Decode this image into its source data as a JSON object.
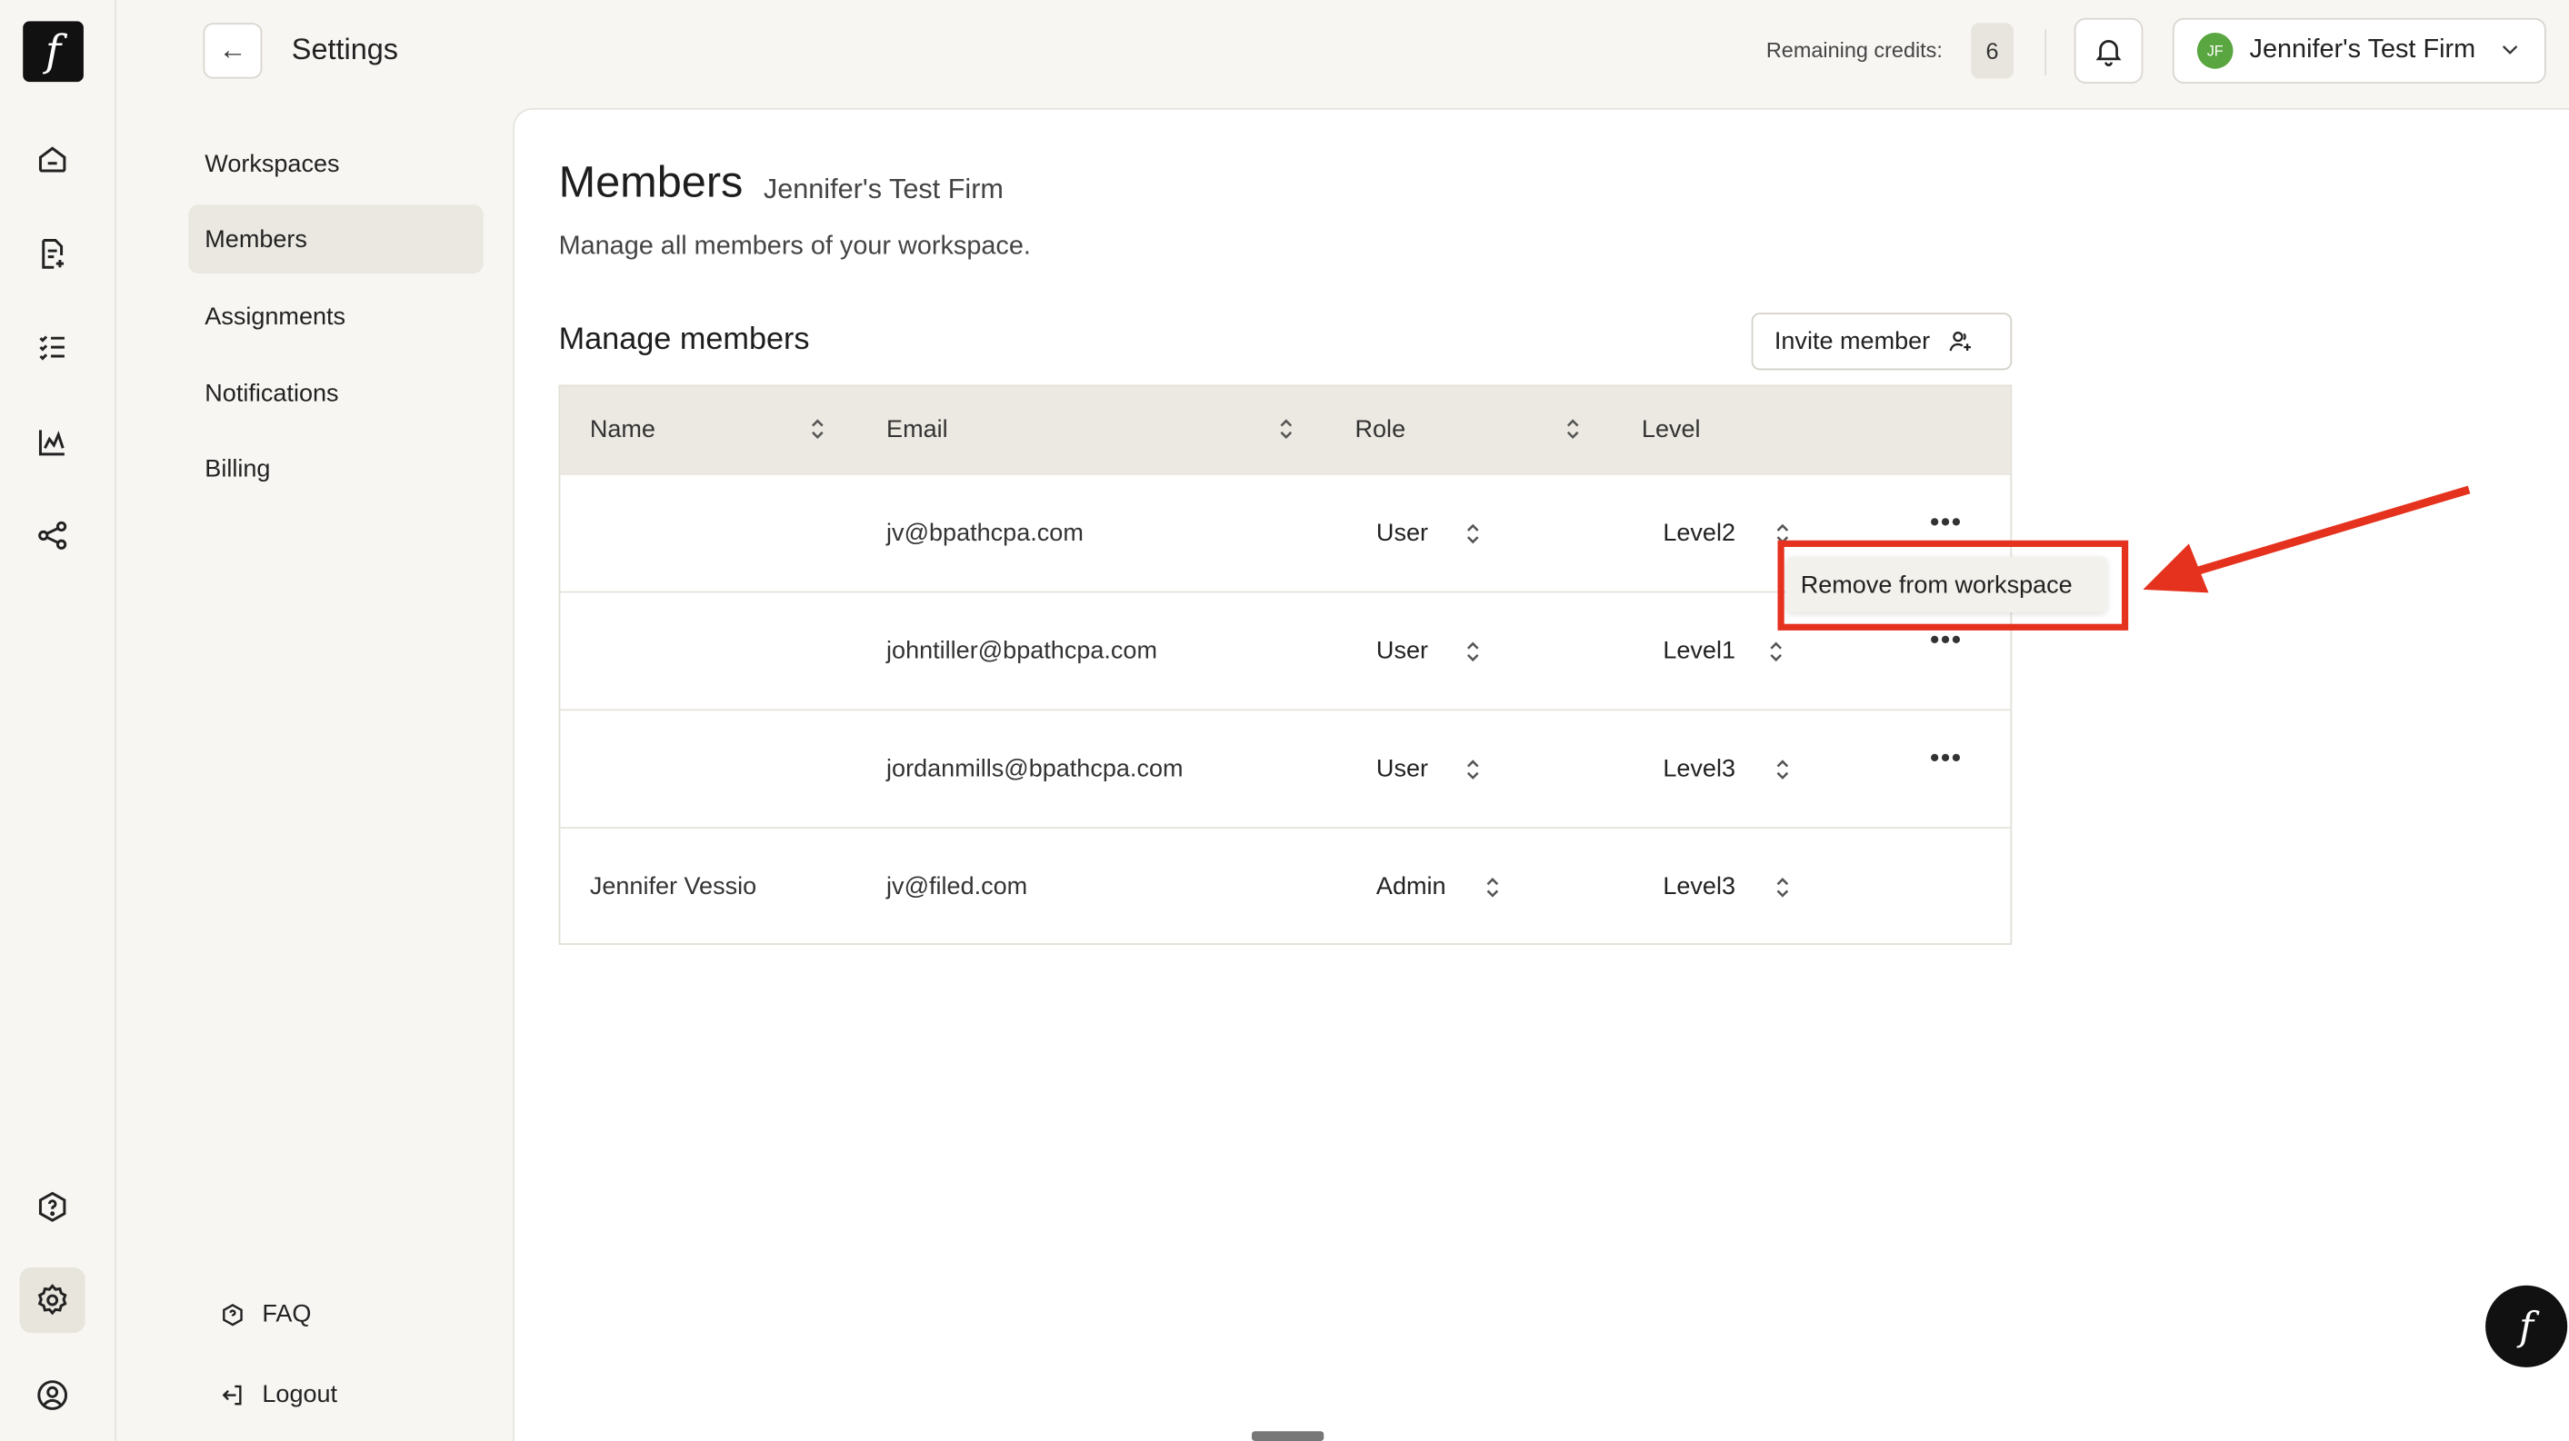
{
  "brand": {
    "logo_glyph": "f",
    "accent": "#e5321e"
  },
  "topbar": {
    "back_icon": "arrow-left-icon",
    "title": "Settings",
    "credits_label": "Remaining credits:",
    "credits_value": "6",
    "firm_initials": "JF",
    "firm_name": "Jennifer's Test Firm"
  },
  "rail": [
    "home-icon",
    "document-icon",
    "checklist-icon",
    "chart-icon",
    "share-icon",
    "help-icon",
    "settings-icon",
    "account-icon"
  ],
  "nav": {
    "items": [
      {
        "label": "Workspaces"
      },
      {
        "label": "Members",
        "active": true
      },
      {
        "label": "Assignments"
      },
      {
        "label": "Notifications"
      },
      {
        "label": "Billing"
      }
    ],
    "faq": "FAQ",
    "logout": "Logout"
  },
  "main": {
    "title": "Members",
    "subtitle": "Jennifer's Test Firm",
    "description": "Manage all members of your workspace.",
    "section_title": "Manage members",
    "invite_label": "Invite member"
  },
  "table": {
    "headers": [
      "Name",
      "Email",
      "Role",
      "Level"
    ],
    "rows": [
      {
        "name": "",
        "email": "jv@bpathcpa.com",
        "role": "User",
        "level": "Level2",
        "menu": "•••"
      },
      {
        "name": "",
        "email": "johntiller@bpathcpa.com",
        "role": "User",
        "level": "Level1",
        "menu": "•••"
      },
      {
        "name": "",
        "email": "jordanmills@bpathcpa.com",
        "role": "User",
        "level": "Level3",
        "menu": "•••"
      },
      {
        "name": "Jennifer Vessio",
        "email": "jv@filed.com",
        "role": "Admin",
        "level": "Level3",
        "menu": ""
      }
    ]
  },
  "context_menu": {
    "item": "Remove from workspace"
  },
  "fab_glyph": "f"
}
